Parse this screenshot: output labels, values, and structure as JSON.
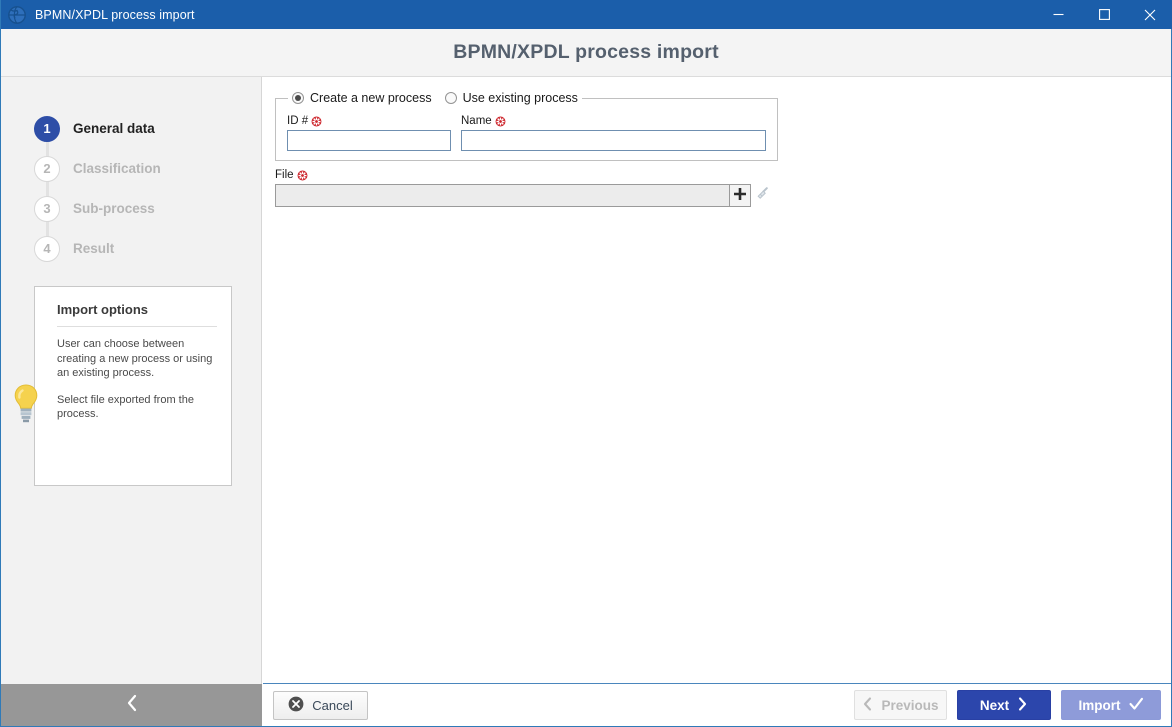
{
  "window": {
    "title": "BPMN/XPDL process import",
    "icon": "globe-icon",
    "minimize_label": "Minimize",
    "maximize_label": "Maximize",
    "close_label": "Close"
  },
  "header": {
    "title": "BPMN/XPDL process import"
  },
  "sidebar": {
    "steps": [
      {
        "number": "1",
        "label": "General data",
        "state": "active"
      },
      {
        "number": "2",
        "label": "Classification",
        "state": "inactive"
      },
      {
        "number": "3",
        "label": "Sub-process",
        "state": "inactive"
      },
      {
        "number": "4",
        "label": "Result",
        "state": "inactive"
      }
    ],
    "tip": {
      "icon": "lightbulb-icon",
      "title": "Import options",
      "paragraphs": [
        "User can choose between creating a new process or using an existing process.",
        "Select file exported from the process."
      ]
    },
    "collapse": {
      "icon": "chevron-left-icon",
      "label": ""
    }
  },
  "form": {
    "process_group": {
      "options": [
        {
          "label": "Create a new process",
          "selected": true
        },
        {
          "label": "Use existing process",
          "selected": false
        }
      ],
      "fields": [
        {
          "label": "ID #",
          "required": true,
          "value": "",
          "placeholder": ""
        },
        {
          "label": "Name",
          "required": true,
          "value": "",
          "placeholder": ""
        }
      ]
    },
    "file": {
      "label": "File",
      "required": true,
      "value": "",
      "placeholder": "",
      "add_icon": "plus-icon",
      "clear_icon": "broom-icon"
    }
  },
  "footer": {
    "cancel": {
      "label": "Cancel",
      "icon": "close-circle-icon"
    },
    "previous": {
      "label": "Previous",
      "icon": "chevron-left-icon",
      "disabled": true
    },
    "next": {
      "label": "Next",
      "icon": "chevron-right-icon"
    },
    "import": {
      "label": "Import",
      "icon": "check-icon",
      "disabled": true
    }
  },
  "colors": {
    "titlebar": "#1b5eaa",
    "accent_blue": "#2c46ac",
    "step_active": "#2e4ea7",
    "import_blue": "#8e9bd9",
    "sidebar_bg": "#f2f2f2",
    "header_bg": "#f4f4f4",
    "collapse_bar": "#979797",
    "required_red": "#cc2128",
    "bulb_yellow": "#f2cf4a"
  }
}
